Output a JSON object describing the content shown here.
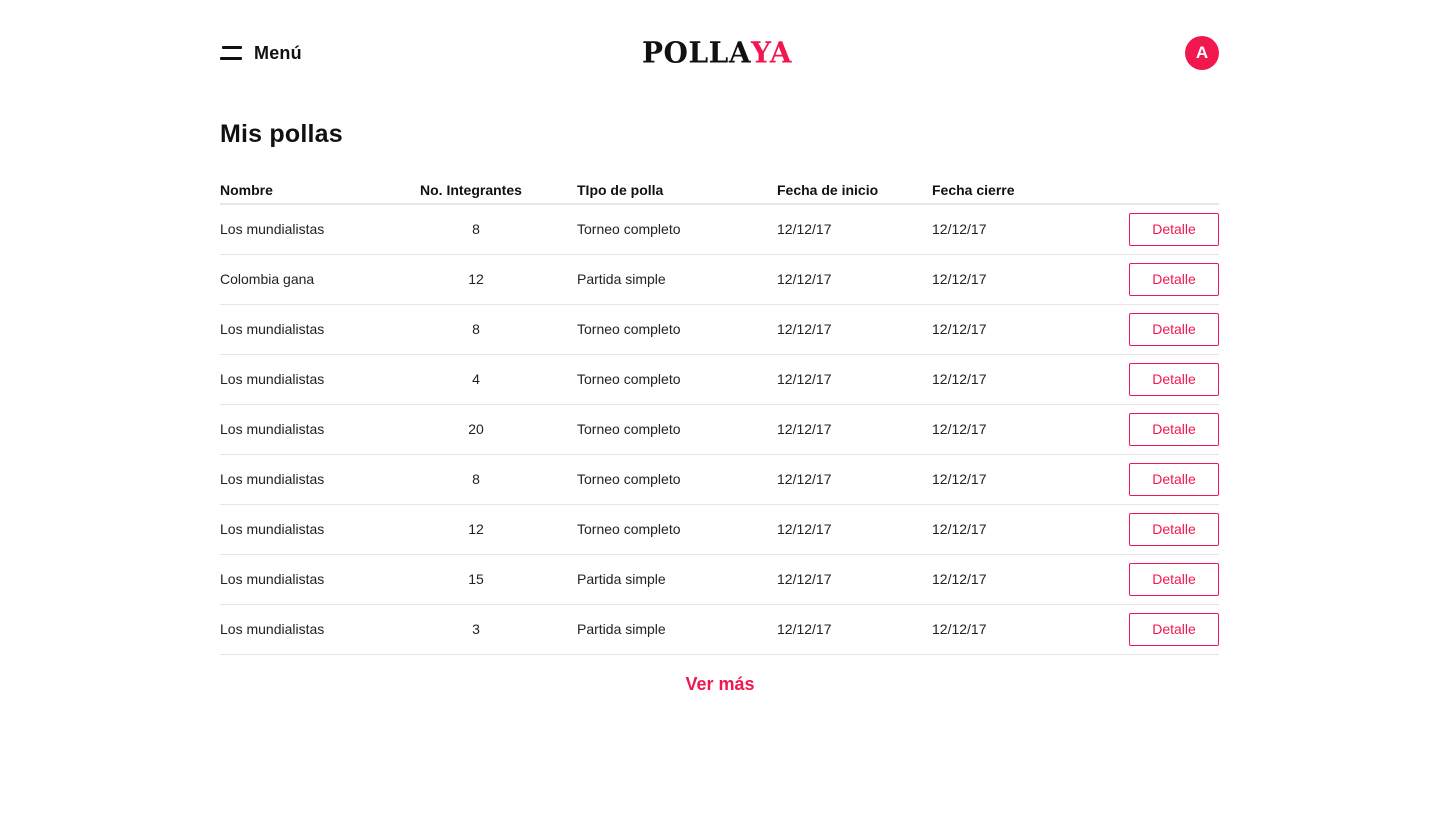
{
  "header": {
    "menu_label": "Menú",
    "logo_part1": "POLLA",
    "logo_part2": "YA",
    "avatar_initial": "A"
  },
  "page": {
    "title": "Mis pollas"
  },
  "table": {
    "columns": {
      "nombre": "Nombre",
      "integrantes": "No. Integrantes",
      "tipo": "TIpo de polla",
      "inicio": "Fecha de inicio",
      "cierre": "Fecha cierre"
    },
    "rows": [
      {
        "nombre": "Los mundialistas",
        "integrantes": "8",
        "tipo": "Torneo completo",
        "inicio": "12/12/17",
        "cierre": "12/12/17",
        "action": "Detalle"
      },
      {
        "nombre": "Colombia gana",
        "integrantes": "12",
        "tipo": "Partida simple",
        "inicio": "12/12/17",
        "cierre": "12/12/17",
        "action": "Detalle"
      },
      {
        "nombre": "Los mundialistas",
        "integrantes": "8",
        "tipo": "Torneo completo",
        "inicio": "12/12/17",
        "cierre": "12/12/17",
        "action": "Detalle"
      },
      {
        "nombre": "Los mundialistas",
        "integrantes": "4",
        "tipo": "Torneo completo",
        "inicio": "12/12/17",
        "cierre": "12/12/17",
        "action": "Detalle"
      },
      {
        "nombre": "Los mundialistas",
        "integrantes": "20",
        "tipo": "Torneo completo",
        "inicio": "12/12/17",
        "cierre": "12/12/17",
        "action": "Detalle"
      },
      {
        "nombre": "Los mundialistas",
        "integrantes": "8",
        "tipo": "Torneo completo",
        "inicio": "12/12/17",
        "cierre": "12/12/17",
        "action": "Detalle"
      },
      {
        "nombre": "Los mundialistas",
        "integrantes": "12",
        "tipo": "Torneo completo",
        "inicio": "12/12/17",
        "cierre": "12/12/17",
        "action": "Detalle"
      },
      {
        "nombre": "Los mundialistas",
        "integrantes": "15",
        "tipo": "Partida simple",
        "inicio": "12/12/17",
        "cierre": "12/12/17",
        "action": "Detalle"
      },
      {
        "nombre": "Los mundialistas",
        "integrantes": "3",
        "tipo": "Partida simple",
        "inicio": "12/12/17",
        "cierre": "12/12/17",
        "action": "Detalle"
      }
    ]
  },
  "footer": {
    "ver_mas": "Ver más"
  },
  "colors": {
    "accent": "#f0184f",
    "text": "#111111",
    "divider": "#e6e6e6"
  },
  "icons": {
    "menu": "hamburger-icon"
  }
}
